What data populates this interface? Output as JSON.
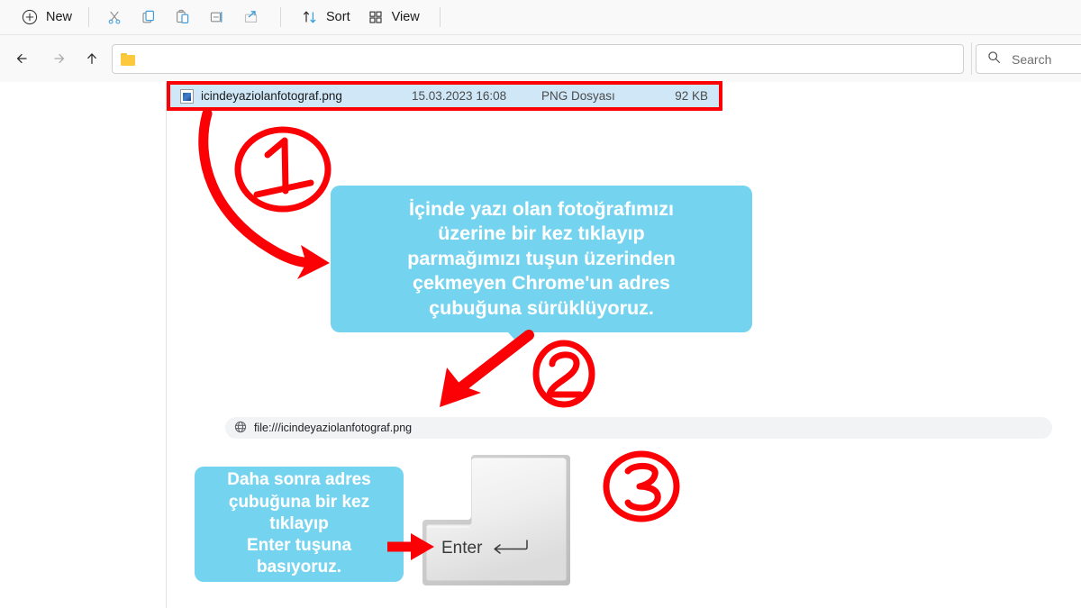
{
  "toolbar": {
    "new_label": "New",
    "sort_label": "Sort",
    "view_label": "View",
    "icons": {
      "new": "plus-circle-icon",
      "cut": "scissors-icon",
      "copy": "copy-icon",
      "paste": "paste-icon",
      "rename": "rename-icon",
      "share": "share-icon",
      "sort": "sort-arrows-icon",
      "view": "grid-view-icon"
    }
  },
  "nav": {
    "back": "back-arrow-icon",
    "forward": "forward-arrow-icon",
    "up": "up-arrow-icon",
    "address_value": "",
    "address_icon": "folder-icon"
  },
  "search": {
    "placeholder": "Search",
    "icon": "search-icon"
  },
  "file_row": {
    "name": "icindeyaziolanfotograf.png",
    "date": "15.03.2023 16:08",
    "type": "PNG Dosyası",
    "size": "92 KB",
    "icon": "image-file-icon",
    "selected": true,
    "highlight_color": "#fb0004"
  },
  "callouts": {
    "bubble1": "İçinde yazı olan fotoğrafımızı\nüzerine bir kez tıklayıp\nparmağımızı tuşun üzerinden\nçekmeyen Chrome'un adres\nçubuğuna sürüklüyoruz.",
    "bubble2": "Daha sonra adres\nçubuğuna bir kez\ntıklayıp\nEnter tuşuna\nbasıyoruz.",
    "bubble_color": "#74d3ef",
    "text_color": "#ffffff"
  },
  "steps": {
    "one": "1",
    "two": "2",
    "three": "3",
    "marker_color": "#fb0004"
  },
  "omnibox": {
    "url": "file:///icindeyaziolanfotograf.png",
    "icon": "globe-icon"
  },
  "enter_key": {
    "label": "Enter",
    "arrow": "enter-return-arrow-icon"
  }
}
